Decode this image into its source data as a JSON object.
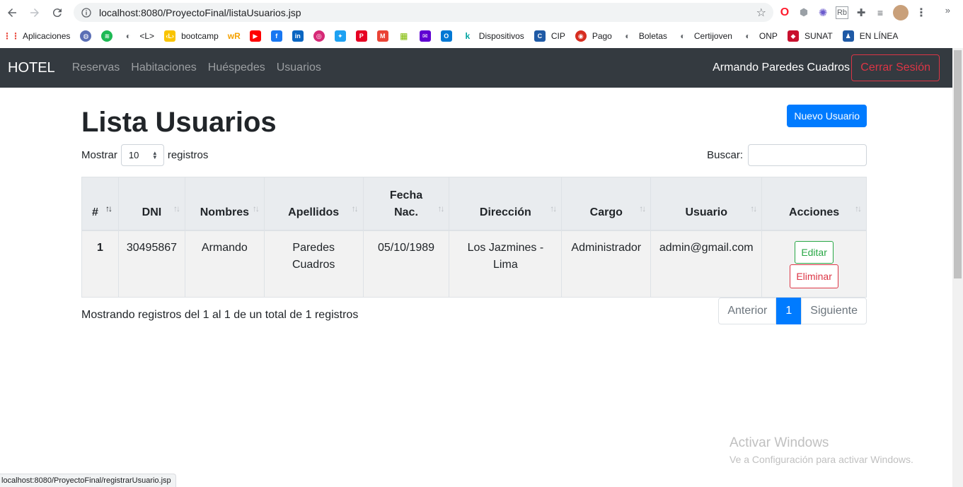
{
  "browser": {
    "url": "localhost:8080/ProyectoFinal/listaUsuarios.jsp",
    "status_url": "localhost:8080/ProyectoFinal/registrarUsuario.jsp",
    "bookmarks": [
      {
        "label": "Aplicaciones",
        "icon": "apps-grid-icon",
        "color": "#e94235"
      },
      {
        "label": "",
        "icon": "globe-icon",
        "color": "#5b6fb5"
      },
      {
        "label": "",
        "icon": "spotify-icon",
        "color": "#1db954"
      },
      {
        "label": "<L>",
        "icon": "world-icon",
        "color": "#5f6368"
      },
      {
        "label": "bootcamp",
        "icon": "bootcamp-icon",
        "color": "#f9c400"
      },
      {
        "label": "",
        "icon": "wr-icon",
        "color": "#f4a100"
      },
      {
        "label": "",
        "icon": "youtube-icon",
        "color": "#ff0000"
      },
      {
        "label": "",
        "icon": "facebook-icon",
        "color": "#1877f2"
      },
      {
        "label": "",
        "icon": "linkedin-icon",
        "color": "#0a66c2"
      },
      {
        "label": "",
        "icon": "instagram-icon",
        "color": "#d62976"
      },
      {
        "label": "",
        "icon": "twitter-icon",
        "color": "#1da1f2"
      },
      {
        "label": "",
        "icon": "pinterest-icon",
        "color": "#e60023"
      },
      {
        "label": "",
        "icon": "gmail-icon",
        "color": "#ea4335"
      },
      {
        "label": "",
        "icon": "microsoft-icon",
        "color": "#7fba00"
      },
      {
        "label": "",
        "icon": "yahoo-mail-icon",
        "color": "#6001d2"
      },
      {
        "label": "",
        "icon": "outlook-icon",
        "color": "#0078d4"
      },
      {
        "label": "Dispositivos",
        "icon": "k-icon",
        "color": "#00a3a0"
      },
      {
        "label": "CIP",
        "icon": "cip-icon",
        "color": "#1f5aa6"
      },
      {
        "label": "Pago",
        "icon": "pago-icon",
        "color": "#d62d20"
      },
      {
        "label": "Boletas",
        "icon": "world-icon",
        "color": "#5f6368"
      },
      {
        "label": "Certijoven",
        "icon": "world-icon",
        "color": "#5f6368"
      },
      {
        "label": "ONP",
        "icon": "world-icon",
        "color": "#5f6368"
      },
      {
        "label": "SUNAT",
        "icon": "sunat-icon",
        "color": "#c8102e"
      },
      {
        "label": "EN LÍNEA",
        "icon": "people-icon",
        "color": "#1f5aa6"
      }
    ],
    "more_bookmarks": "»"
  },
  "navbar": {
    "brand": "HOTEL",
    "links": [
      "Reservas",
      "Habitaciones",
      "Huéspedes",
      "Usuarios"
    ],
    "user_name": "Armando Paredes Cuadros",
    "logout_label": "Cerrar Sesión"
  },
  "page": {
    "title": "Lista Usuarios",
    "new_button": "Nuevo Usuario",
    "show_label": "Mostrar",
    "show_value": "10",
    "records_label": "registros",
    "search_label": "Buscar:",
    "search_value": ""
  },
  "table": {
    "headers": [
      "#",
      "DNI",
      "Nombres",
      "Apellidos",
      "Fecha Nac.",
      "Dirección",
      "Cargo",
      "Usuario",
      "Acciones"
    ],
    "rows": [
      {
        "num": "1",
        "dni": "30495867",
        "nombres": "Armando",
        "apellidos": "Paredes Cuadros",
        "fecha": "05/10/1989",
        "direccion": "Los Jazmines - Lima",
        "cargo": "Administrador",
        "usuario": "admin@gmail.com",
        "edit_label": "Editar",
        "delete_label": "Eliminar"
      }
    ]
  },
  "footer": {
    "info": "Mostrando registros del 1 al 1 de un total de 1 registros",
    "prev": "Anterior",
    "page": "1",
    "next": "Siguiente"
  },
  "watermark": {
    "line1": "Activar Windows",
    "line2": "Ve a Configuración para activar Windows."
  },
  "colors": {
    "navbar_bg": "#343a40",
    "primary": "#007bff",
    "danger": "#dc3545",
    "success": "#28a745"
  }
}
